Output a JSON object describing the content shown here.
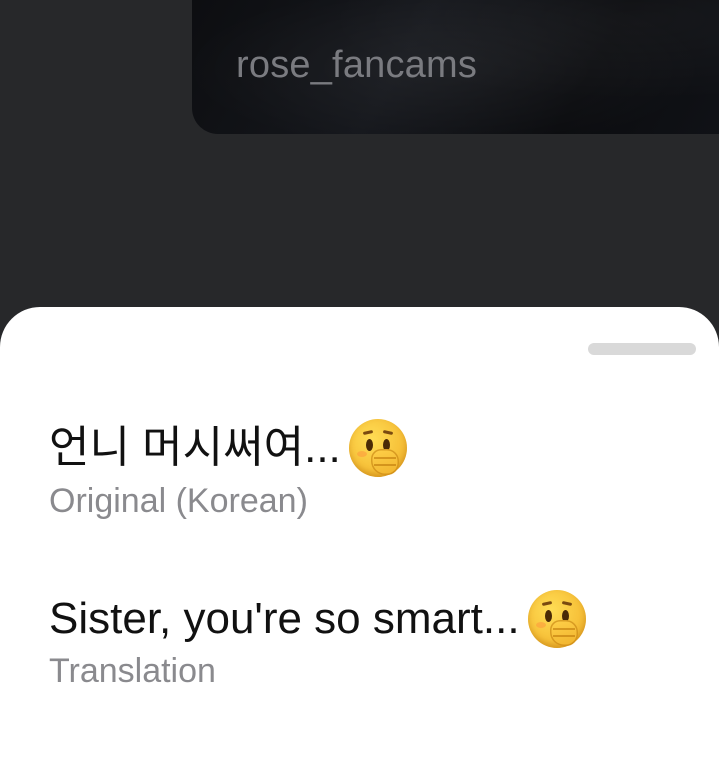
{
  "background": {
    "video_username": "rose_fancams"
  },
  "sheet": {
    "original": {
      "text": "언니 머시써여...",
      "emoji_icon": "face-with-hand-over-mouth-icon",
      "label": "Original (Korean)"
    },
    "translation": {
      "text": "Sister, you're so smart... ",
      "emoji_icon": "face-with-hand-over-mouth-icon",
      "label": "Translation"
    }
  },
  "colors": {
    "background": "#27282a",
    "sheet": "#ffffff",
    "primary_text": "#111111",
    "secondary_text": "#8a8a8e",
    "grabber": "#d9d9d9"
  }
}
